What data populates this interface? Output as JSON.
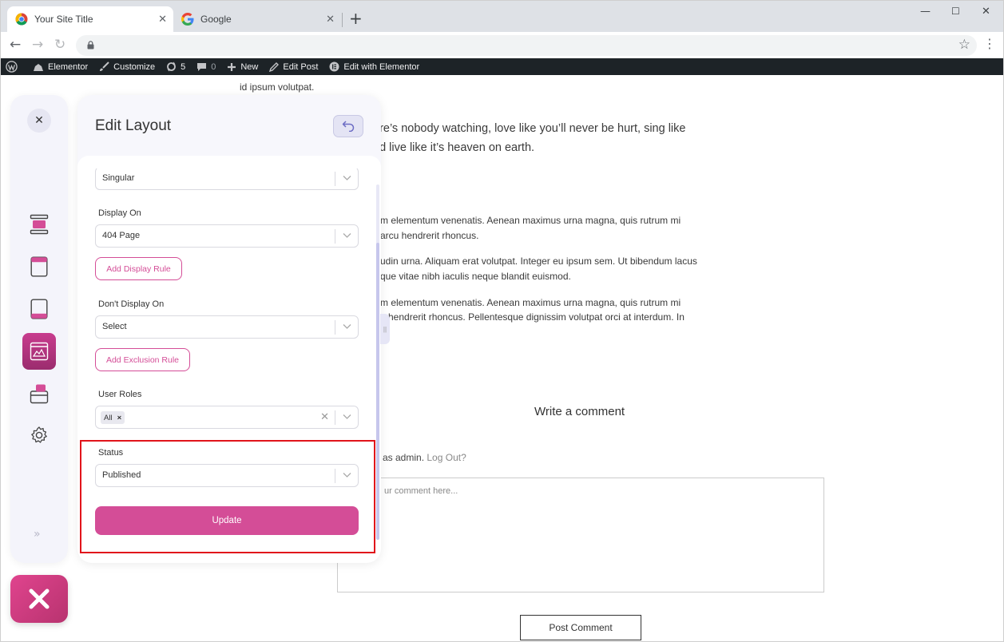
{
  "browser": {
    "tabs": [
      {
        "title": "Your Site Title",
        "active": true
      },
      {
        "title": "Google",
        "active": false
      }
    ]
  },
  "admin_bar": {
    "items": [
      {
        "icon": "wordpress-icon",
        "label": ""
      },
      {
        "icon": "elementor-icon",
        "label": "Elementor"
      },
      {
        "icon": "brush-icon",
        "label": "Customize"
      },
      {
        "icon": "updates-icon",
        "label": "5"
      },
      {
        "icon": "comment-icon",
        "label": "0"
      },
      {
        "icon": "plus-icon",
        "label": "New"
      },
      {
        "icon": "pencil-icon",
        "label": "Edit Post"
      },
      {
        "icon": "elementor-circle-icon",
        "label": "Edit with Elementor"
      }
    ]
  },
  "page": {
    "line_top": "id ipsum volutpat.",
    "quote_1": "ere’s nobody watching, love like you’ll never be hurt, sing like",
    "quote_2": "nd live like it’s heaven on earth.",
    "p1_1": "m elementum venenatis. Aenean maximus urna magna, quis rutrum mi",
    "p1_2": "arcu hendrerit rhoncus.",
    "p2_1": "udin urna. Aliquam erat volutpat. Integer eu ipsum sem. Ut bibendum lacus",
    "p2_2": "que vitae nibh iaculis neque blandit euismod.",
    "p3_1": "m elementum venenatis. Aenean maximus urna magna, quis rutrum mi",
    "p3_2": "u hendrerit rhoncus. Pellentesque dignissim volutpat orci at interdum. In",
    "comment_title": "Write a comment",
    "logged_in": "as admin.",
    "logout": "Log Out?",
    "comment_placeholder": "ur comment here...",
    "post_comment": "Post Comment"
  },
  "panel": {
    "title": "Edit Layout",
    "condition_value": "Singular",
    "display_on_label": "Display On",
    "display_on_value": "404 Page",
    "add_display_rule": "Add Display Rule",
    "dont_display_label": "Don't Display On",
    "dont_display_value": "Select",
    "add_exclusion_rule": "Add Exclusion Rule",
    "user_roles_label": "User Roles",
    "user_roles_tag": "All",
    "status_label": "Status",
    "status_value": "Published",
    "update_label": "Update"
  },
  "colors": {
    "accent": "#d44d97",
    "highlight": "#e1141b",
    "admin_bar": "#1d2327"
  }
}
